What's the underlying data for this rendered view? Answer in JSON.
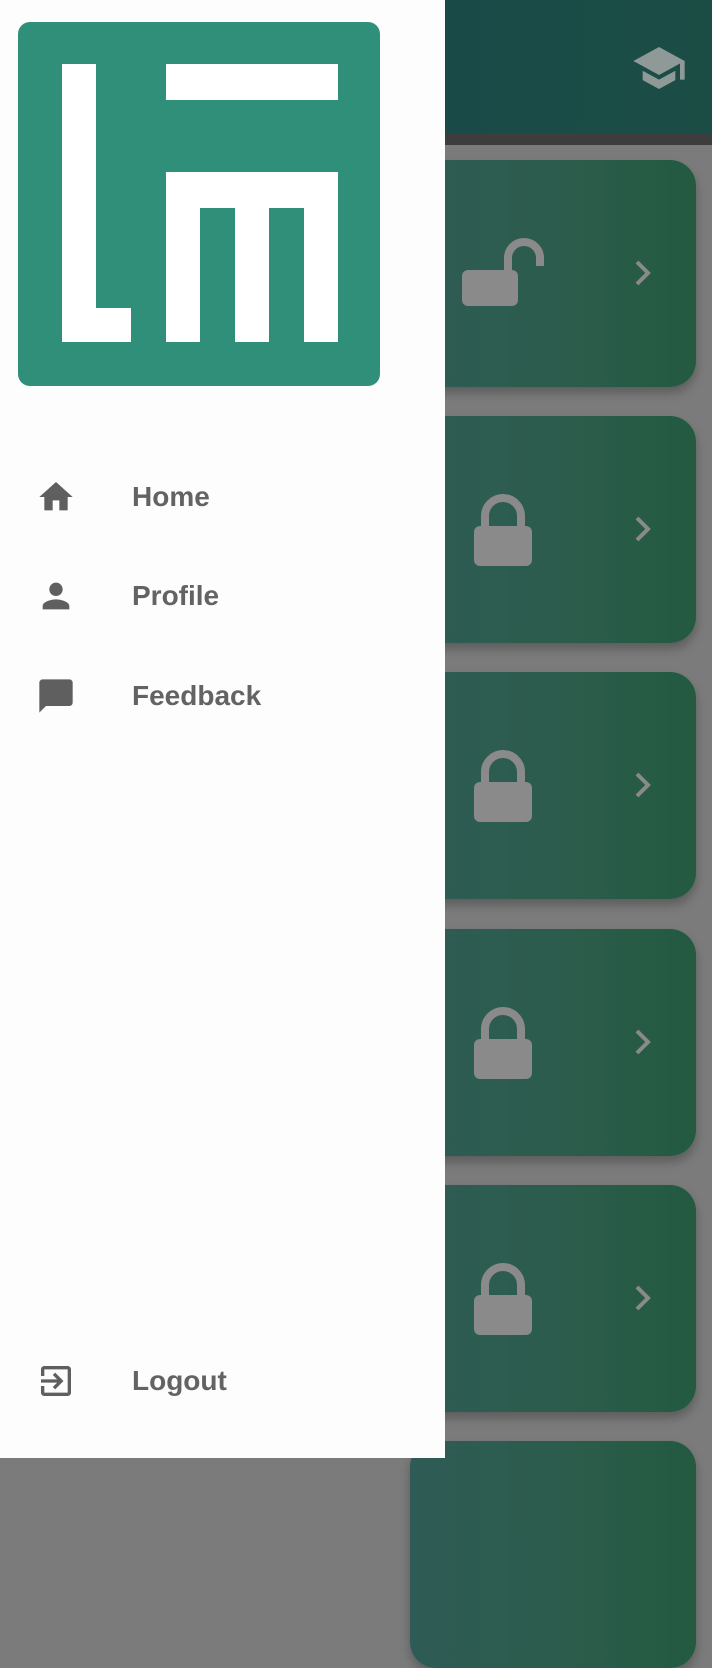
{
  "colors": {
    "brand": "#2f8f78",
    "appbar": "#1b4a45",
    "drawer_bg": "#fcfdfc",
    "nav_text": "#636363",
    "icon": "#5f5f5f",
    "card": "#2c5b4e",
    "card_icon": "#8a8a8a"
  },
  "header": {
    "action_icon": "graduation-cap-icon"
  },
  "cards": [
    {
      "icon": "lock-open-icon",
      "action_icon": "chevron-right-icon"
    },
    {
      "icon": "lock-icon",
      "action_icon": "chevron-right-icon"
    },
    {
      "icon": "lock-icon",
      "action_icon": "chevron-right-icon"
    },
    {
      "icon": "lock-icon",
      "action_icon": "chevron-right-icon"
    },
    {
      "icon": "lock-icon",
      "action_icon": "chevron-right-icon"
    }
  ],
  "drawer": {
    "logo_text": "LM",
    "items": [
      {
        "label": "Home",
        "icon": "home-icon"
      },
      {
        "label": "Profile",
        "icon": "person-icon"
      },
      {
        "label": "Feedback",
        "icon": "feedback-icon"
      }
    ],
    "logout": {
      "label": "Logout",
      "icon": "logout-icon"
    }
  }
}
